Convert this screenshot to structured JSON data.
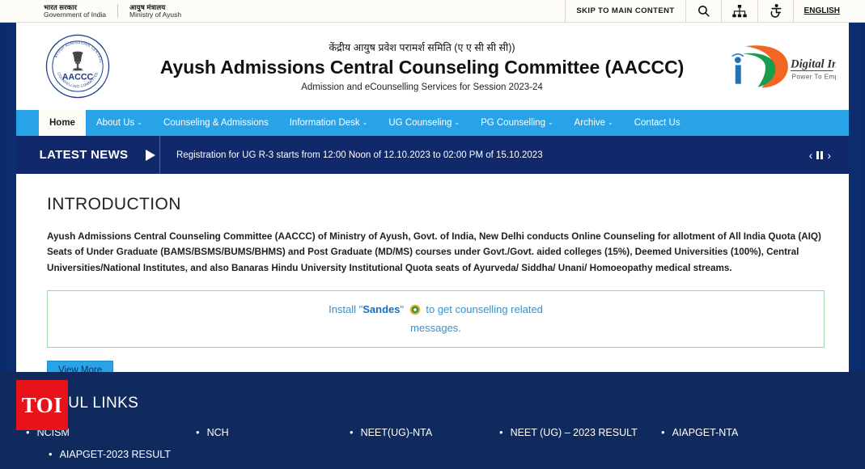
{
  "gov_strip": {
    "emblem_blocks": [
      {
        "hindi": "भारत सरकार",
        "english": "Government of India"
      },
      {
        "hindi": "आयुष मंत्रालय",
        "english": "Ministry of Ayush"
      }
    ],
    "skip_to_main": "SKIP TO MAIN CONTENT",
    "icons": [
      "search-icon",
      "sitemap-icon",
      "accessibility-icon"
    ],
    "language": "ENGLISH"
  },
  "masthead": {
    "logo_text": "AACCC",
    "logo_ring_text": "AYUSH ADMISSIONS CENTRAL COUNSELLING COMMITTEE",
    "title_hindi": "केंद्रीय आयुष प्रवेश परामर्श समिति (ए ए सी सी सी))",
    "title_english": "Ayush Admissions Central Counseling Committee (AACCC)",
    "subtitle": "Admission and eCounselling Services for Session 2023-24",
    "digital_india": {
      "name": "Digital India",
      "tagline": "Power To Empower"
    }
  },
  "nav": {
    "items": [
      {
        "label": "Home",
        "caret": false,
        "active": true
      },
      {
        "label": "About Us",
        "caret": true,
        "active": false
      },
      {
        "label": "Counseling & Admissions",
        "caret": false,
        "active": false
      },
      {
        "label": "Information Desk",
        "caret": true,
        "active": false
      },
      {
        "label": "UG Counseling",
        "caret": true,
        "active": false
      },
      {
        "label": "PG Counselling",
        "caret": true,
        "active": false
      },
      {
        "label": "Archive",
        "caret": true,
        "active": false
      },
      {
        "label": "Contact Us",
        "caret": false,
        "active": false
      }
    ]
  },
  "news": {
    "label": "LATEST NEWS",
    "item": "Registration for UG R-3 starts from 12:00 Noon of 12.10.2023 to 02:00 PM of 15.10.2023",
    "controls": {
      "prev": "‹",
      "pause": "pause-icon",
      "next": "›"
    }
  },
  "intro": {
    "heading": "INTRODUCTION",
    "body": "Ayush Admissions Central Counseling Committee (AACCC) of Ministry of Ayush, Govt. of India, New Delhi conducts Online Counseling for allotment of All India Quota (AIQ) Seats of Under Graduate (BAMS/BSMS/BUMS/BHMS) and Post Graduate (MD/MS) courses under Govt./Govt. aided colleges (15%), Deemed Universities (100%), Central Universities/National Institutes, and also Banaras Hindu University Institutional Quota seats of Ayurveda/ Siddha/ Unani/ Homoeopathy medical streams.",
    "sandes_prefix": "Install \"",
    "sandes_app": "Sandes",
    "sandes_suffix": "\" ",
    "sandes_rest": " to get counselling related messages.",
    "view_more": "View More"
  },
  "useful_links": {
    "heading": "USEFUL LINKS",
    "items": [
      "NCISM",
      "NCH",
      "NEET(UG)-NTA",
      "NEET (UG) – 2023 RESULT",
      "AIAPGET-NTA",
      "AIAPGET-2023 RESULT"
    ]
  },
  "watermark": {
    "label": "TOI",
    "color": "#e8121a"
  },
  "colors": {
    "nav_blue": "#29a3e8",
    "news_navy": "#11296b",
    "footer_navy": "#102a5e",
    "page_edge": "#0a2a6b"
  }
}
